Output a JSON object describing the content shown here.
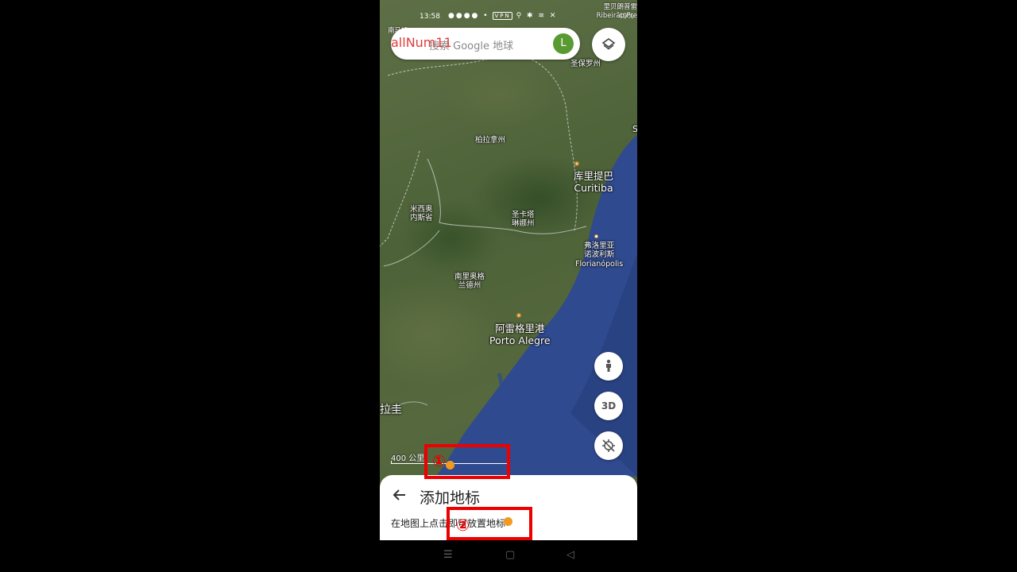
{
  "status_bar": {
    "time": "13:58",
    "vpn": "VPN",
    "battery": "49%",
    "overlay_top_right_1": "里贝朗普雷",
    "overlay_top_right_2": "Ribeirão Pre",
    "overlay_top_left": "南马托"
  },
  "overlay": {
    "red_text": "allNum11"
  },
  "search": {
    "placeholder": "搜索 Google 地球",
    "avatar_letter": "L"
  },
  "map_labels": {
    "sao_paulo_state": "圣保罗州",
    "parana": "柏拉拿州",
    "curitiba_zh": "库里提巴",
    "curitiba_en": "Curitiba",
    "misiones_1": "米西奥",
    "misiones_2": "内斯省",
    "santa_catarina_1": "圣卡塔",
    "santa_catarina_2": "琳娜州",
    "florianopolis_1": "弗洛里亚",
    "florianopolis_2": "诺波利斯",
    "florianopolis_en": "Florianópolis",
    "rio_grande_1": "南里奥格",
    "rio_grande_2": "兰德州",
    "porto_alegre_zh": "阿雷格里港",
    "porto_alegre_en": "Porto Alegre",
    "uruguay": "拉圭",
    "edge_s": "S"
  },
  "fabs": {
    "street_view": "street-view-icon",
    "three_d": "3D",
    "locate": "locate-off-icon"
  },
  "scale": {
    "label": "400 公里"
  },
  "sheet": {
    "title": "添加地标",
    "hint": "在地图上点击即可放置地标"
  },
  "annotations": {
    "marker1": "①",
    "marker2": "②",
    "color": "#e00000",
    "dot_color": "#f39a1e"
  },
  "navbar": {
    "menu": "☰",
    "home": "▢",
    "back": "◁"
  }
}
